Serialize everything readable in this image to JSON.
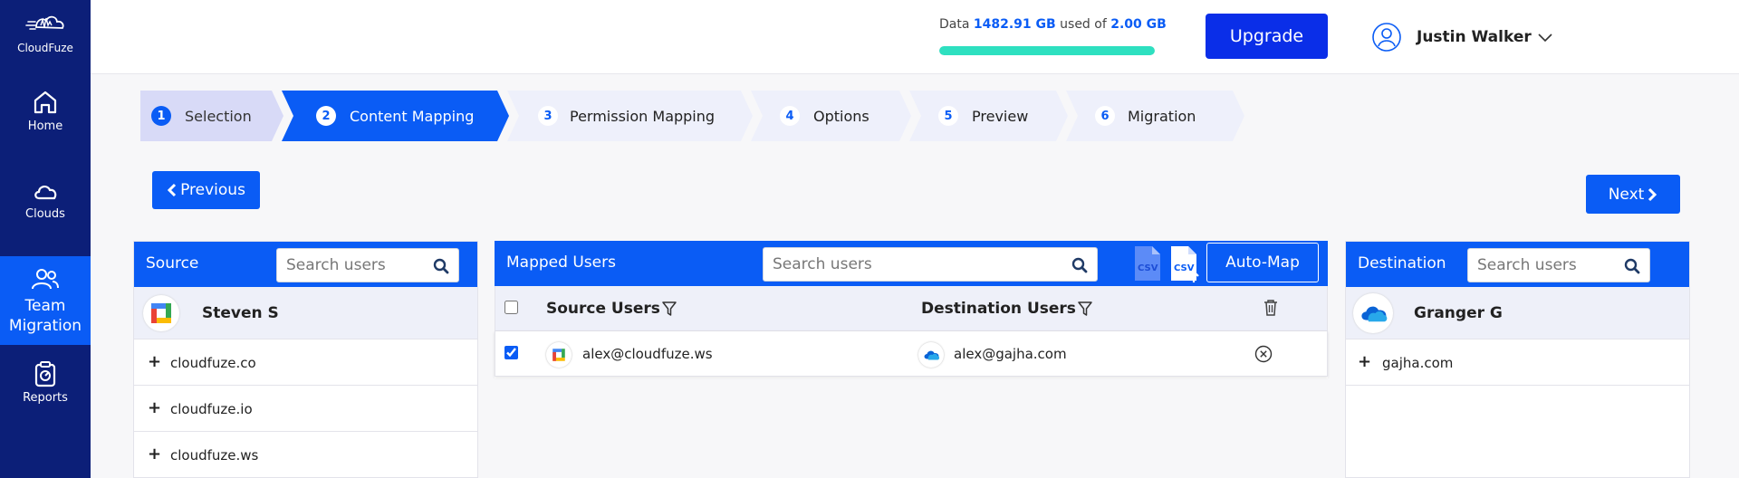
{
  "app": {
    "logo_text": "CloudFuze"
  },
  "sidebar": {
    "items": [
      {
        "label": "Home",
        "icon": "home-icon"
      },
      {
        "label": "Clouds",
        "icon": "cloud-icon"
      },
      {
        "label": "Team Migration",
        "icon": "users-icon",
        "active": true
      },
      {
        "label": "Reports",
        "icon": "clipboard-icon"
      }
    ]
  },
  "header": {
    "usage_prefix": "Data",
    "usage_used": "1482.91 GB",
    "usage_mid": "used of",
    "usage_total": "2.00 GB",
    "usage_fill_fraction": 1.0,
    "upgrade_label": "Upgrade",
    "user_name": "Justin Walker"
  },
  "steps": [
    {
      "num": "1",
      "label": "Selection",
      "state": "done"
    },
    {
      "num": "2",
      "label": "Content Mapping",
      "state": "current"
    },
    {
      "num": "3",
      "label": "Permission Mapping",
      "state": "todo"
    },
    {
      "num": "4",
      "label": "Options",
      "state": "todo"
    },
    {
      "num": "5",
      "label": "Preview",
      "state": "todo"
    },
    {
      "num": "6",
      "label": "Migration",
      "state": "todo"
    }
  ],
  "nav": {
    "previous_label": "Previous",
    "next_label": "Next"
  },
  "source": {
    "title": "Source",
    "search_placeholder": "Search users",
    "user_name": "Steven S",
    "domains": [
      "cloudfuze.co",
      "cloudfuze.io",
      "cloudfuze.ws"
    ]
  },
  "mapped": {
    "title": "Mapped Users",
    "search_placeholder": "Search users",
    "automap_label": "Auto-Map",
    "col_source": "Source Users",
    "col_destination": "Destination Users",
    "rows": [
      {
        "checked": true,
        "source_email": "alex@cloudfuze.ws",
        "dest_email": "alex@gajha.com"
      }
    ]
  },
  "destination": {
    "title": "Destination",
    "search_placeholder": "Search users",
    "user_name": "Granger G",
    "domains": [
      "gajha.com"
    ]
  },
  "colors": {
    "sidebar": "#0c1f78",
    "primary": "#0a5cf5",
    "upgrade": "#0a2ee8",
    "usage_fill": "#2ee0c0",
    "step_done": "#d8daf7",
    "step_todo": "#eef0fb"
  }
}
